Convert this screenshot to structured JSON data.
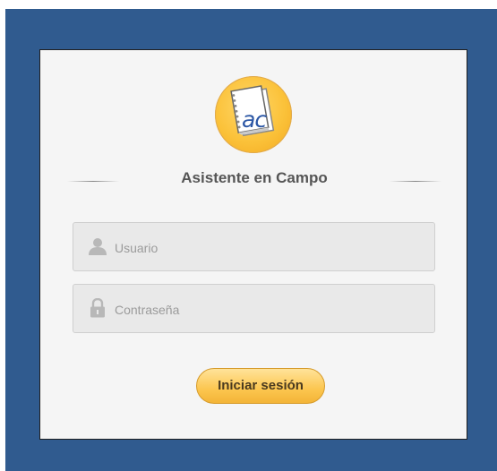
{
  "app": {
    "logo_text": "ac",
    "title": "Asistente en Campo"
  },
  "form": {
    "username_placeholder": "Usuario",
    "password_placeholder": "Contraseña",
    "submit_label": "Iniciar sesión"
  },
  "colors": {
    "background_frame": "#305b8f",
    "card_background": "#f5f5f5",
    "button_gradient_top": "#ffe39a",
    "button_gradient_bottom": "#f3b437",
    "logo_circle": "#fbc23a"
  },
  "icons": {
    "logo": "notebook-logo-icon",
    "user_field": "user-icon",
    "password_field": "lock-icon"
  }
}
